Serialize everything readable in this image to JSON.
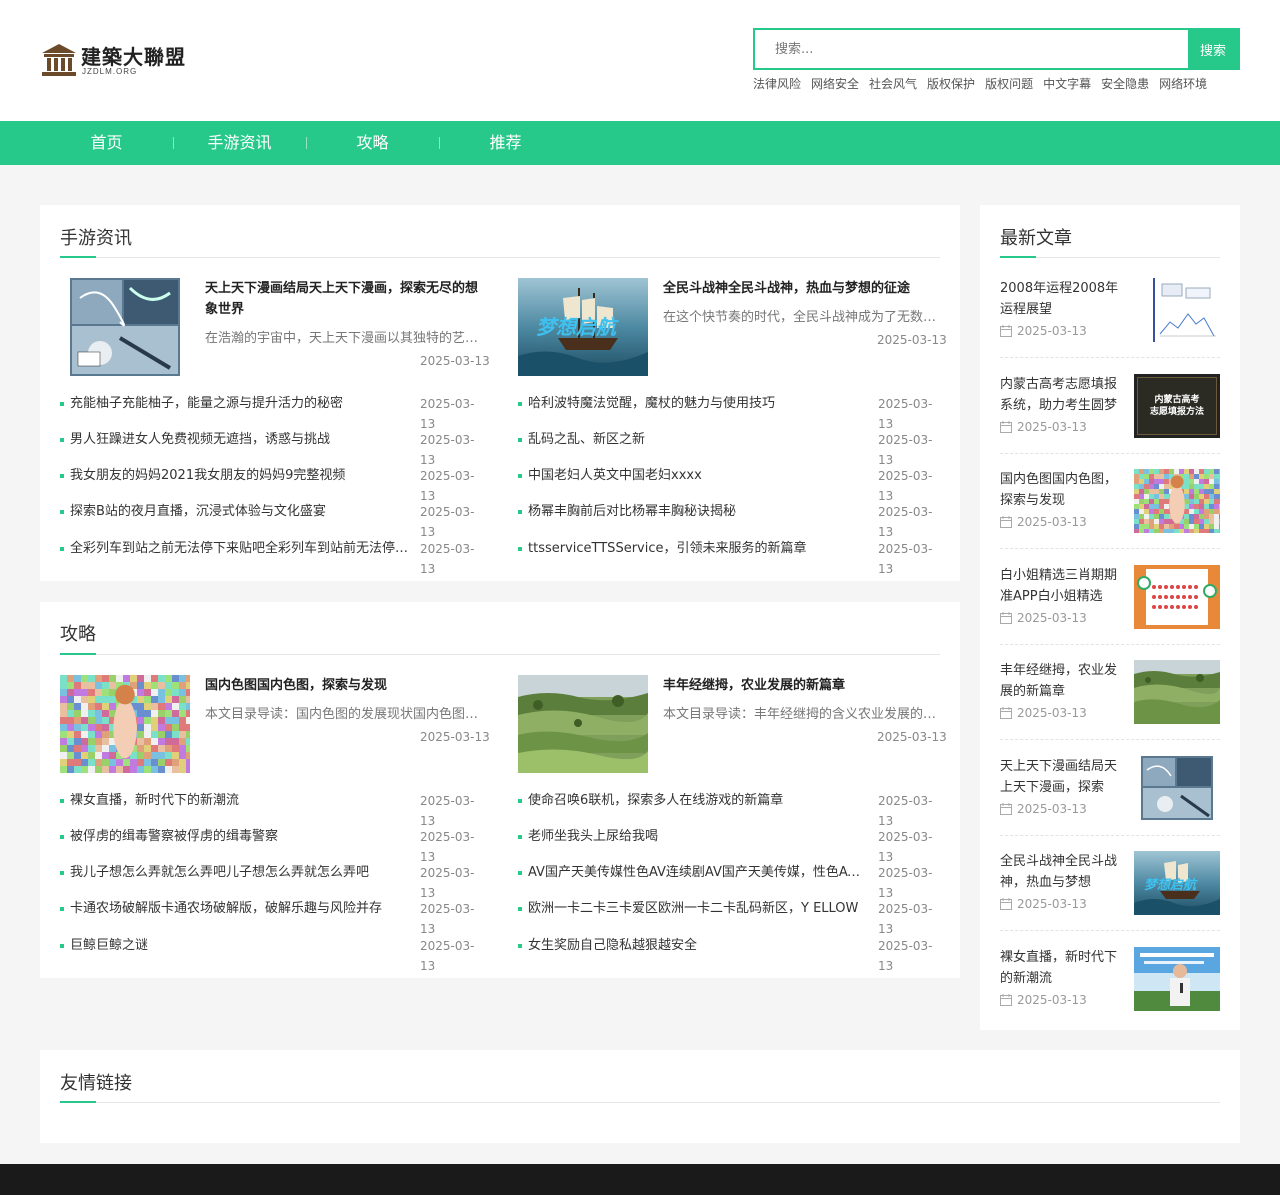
{
  "header": {
    "logo_text": "建築大聯盟",
    "logo_sub": "JZDLM.ORG",
    "search_placeholder": "搜索...",
    "search_button": "搜索",
    "hot_tags": [
      "法律风险",
      "网络安全",
      "社会风气",
      "版权保护",
      "版权问题",
      "中文字幕",
      "安全隐患",
      "网络环境"
    ]
  },
  "nav": {
    "items": [
      "首页",
      "手游资讯",
      "攻略",
      "推荐"
    ]
  },
  "colors": {
    "accent": "#27c98b",
    "footer": "#1a1a1a"
  },
  "sections": [
    {
      "title": "手游资讯",
      "featured": [
        {
          "title": "天上天下漫画结局天上天下漫画，探索无尽的想象世界",
          "desc": "在浩瀚的宇宙中，天上天下漫画以其独特的艺术风格和深刻的主题",
          "date": "2025-03-13",
          "thumb": "manga-image"
        },
        {
          "title": "全民斗战神全民斗战神，热血与梦想的征途",
          "desc": "在这个快节奏的时代，全民斗战神成为了无数玩家心中的热血梦想",
          "date": "2025-03-13",
          "thumb": "ship-image"
        }
      ],
      "left_list": [
        {
          "title": "充能柚子充能柚子，能量之源与提升活力的秘密",
          "date": "2025-03-13"
        },
        {
          "title": "男人狂躁进女人免费视频无遮挡，诱惑与挑战",
          "date": "2025-03-13"
        },
        {
          "title": "我女朋友的妈妈2021我女朋友的妈妈9完整视频",
          "date": "2025-03-13"
        },
        {
          "title": "探索B站的夜月直播，沉浸式体验与文化盛宴",
          "date": "2025-03-13"
        },
        {
          "title": "全彩列车到站之前无法停下来贴吧全彩列车到站前无法停下来",
          "date": "2025-03-13"
        }
      ],
      "right_list": [
        {
          "title": "哈利波特魔法觉醒，魔杖的魅力与使用技巧",
          "date": "2025-03-13"
        },
        {
          "title": "乱码之乱、新区之新",
          "date": "2025-03-13"
        },
        {
          "title": "中国老妇人英文中国老妇xxxx",
          "date": "2025-03-13"
        },
        {
          "title": "杨幂丰胸前后对比杨幂丰胸秘诀揭秘",
          "date": "2025-03-13"
        },
        {
          "title": "ttsserviceTTSService，引领未来服务的新篇章",
          "date": "2025-03-13"
        }
      ]
    },
    {
      "title": "攻略",
      "featured": [
        {
          "title": "国内色图国内色图，探索与发现",
          "desc": "本文目录导读：国内色图的发展现状国内色图的未来展望",
          "date": "2025-03-13",
          "thumb": "mosaic-image"
        },
        {
          "title": "丰年经继拇，农业发展的新篇章",
          "desc": "本文目录导读：丰年经继拇的含义农业发展的新篇章",
          "date": "2025-03-13",
          "thumb": "tea-field-image"
        }
      ],
      "left_list": [
        {
          "title": "裸女直播，新时代下的新潮流",
          "date": "2025-03-13"
        },
        {
          "title": "被俘虏的缉毒警察被俘虏的缉毒警察",
          "date": "2025-03-13"
        },
        {
          "title": "我儿子想怎么弄就怎么弄吧儿子想怎么弄就怎么弄吧",
          "date": "2025-03-13"
        },
        {
          "title": "卡通农场破解版卡通农场破解版，破解乐趣与风险并存",
          "date": "2025-03-13"
        },
        {
          "title": "巨鲸巨鲸之谜",
          "date": "2025-03-13"
        }
      ],
      "right_list": [
        {
          "title": "使命召唤6联机，探索多人在线游戏的新篇章",
          "date": "2025-03-13"
        },
        {
          "title": "老师坐我头上尿给我喝",
          "date": "2025-03-13"
        },
        {
          "title": "AV国产天美传媒性色AV连续剧AV国产天美传媒，性色AV连续剧",
          "date": "2025-03-13"
        },
        {
          "title": "欧洲一卡二卡三卡爱区欧洲一卡二卡乱码新区，Y ELLOW",
          "date": "2025-03-13"
        },
        {
          "title": "女生奖励自己隐私越狠越安全",
          "date": "2025-03-13"
        }
      ]
    }
  ],
  "sidebar": {
    "title": "最新文章",
    "items": [
      {
        "title": "2008年运程2008年运程展望",
        "date": "2025-03-13",
        "thumb": "chart-image"
      },
      {
        "title": "内蒙古高考志愿填报系统，助力考生圆梦",
        "date": "2025-03-13",
        "thumb": "blackboard-image",
        "thumb_text": "内蒙古高考\n志愿填报方法"
      },
      {
        "title": "国内色图国内色图，探索与发现",
        "date": "2025-03-13",
        "thumb": "mosaic-image"
      },
      {
        "title": "白小姐精选三肖期期准APP白小姐精选",
        "date": "2025-03-13",
        "thumb": "lottery-image"
      },
      {
        "title": "丰年经继拇，农业发展的新篇章",
        "date": "2025-03-13",
        "thumb": "tea-field-image"
      },
      {
        "title": "天上天下漫画结局天上天下漫画，探索",
        "date": "2025-03-13",
        "thumb": "manga-image"
      },
      {
        "title": "全民斗战神全民斗战神，热血与梦想",
        "date": "2025-03-13",
        "thumb": "ship-image"
      },
      {
        "title": "裸女直播，新时代下的新潮流",
        "date": "2025-03-13",
        "thumb": "speaker-image"
      }
    ]
  },
  "links": {
    "title": "友情链接"
  }
}
